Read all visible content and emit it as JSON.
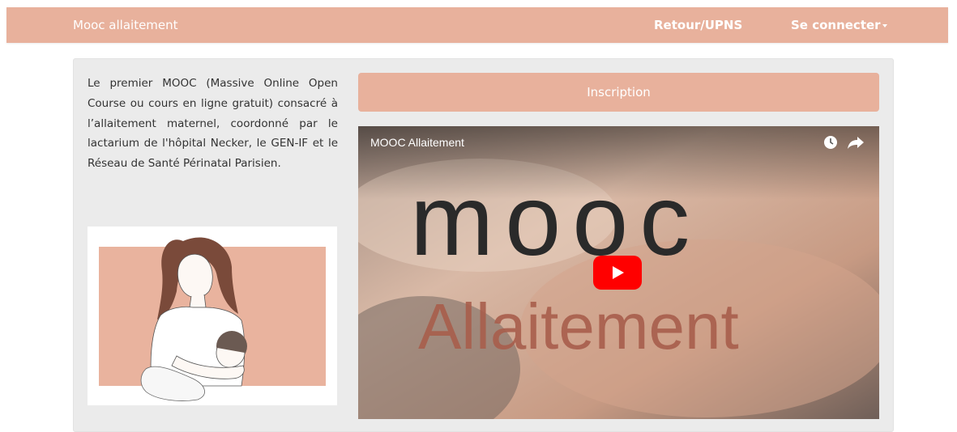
{
  "navbar": {
    "brand": "Mooc allaitement",
    "links": [
      {
        "label": "Retour/UPNS"
      },
      {
        "label": "Se connecter"
      }
    ],
    "color": "#e8b19c"
  },
  "intro": {
    "text": "Le premier MOOC (Massive Online Open Course ou cours en ligne gratuit) consacré à l’allaitement maternel, coordonné par le lactarium de l'hôpital Necker, le GEN-IF et le Réseau de Santé Périnatal Parisien."
  },
  "inscription": {
    "label": "Inscription"
  },
  "video": {
    "title": "MOOC Allaitement",
    "overlay_line1": "mooc",
    "overlay_line2": "Allaitement",
    "icons": [
      "watch-later-icon",
      "share-icon",
      "play-icon"
    ]
  },
  "colors": {
    "accent": "#e8b19c",
    "panel": "#ebebeb",
    "youtube_red": "#ff0000"
  }
}
